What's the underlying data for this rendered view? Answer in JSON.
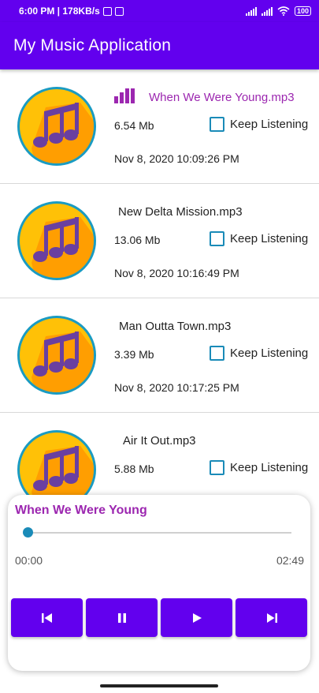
{
  "status_bar": {
    "time_speed": "6:00 PM | 178KB/s",
    "battery": "100"
  },
  "app_bar": {
    "title": "My Music Application"
  },
  "songs": [
    {
      "title": "When We Were Young.mp3",
      "size": "6.54 Mb",
      "date": "Nov 8, 2020 10:09:26 PM",
      "keep_label": "Keep Listening",
      "playing": true
    },
    {
      "title": "New Delta Mission.mp3",
      "size": "13.06 Mb",
      "date": "Nov 8, 2020 10:16:49 PM",
      "keep_label": "Keep Listening",
      "playing": false
    },
    {
      "title": "Man Outta Town.mp3",
      "size": "3.39 Mb",
      "date": "Nov 8, 2020 10:17:25 PM",
      "keep_label": "Keep Listening",
      "playing": false
    },
    {
      "title": "Air It Out.mp3",
      "size": "5.88 Mb",
      "date": "",
      "keep_label": "Keep Listening",
      "playing": false
    }
  ],
  "player": {
    "title": "When We Were Young",
    "current_time": "00:00",
    "total_time": "02:49",
    "progress": 0.0
  },
  "colors": {
    "primary": "#6200ee",
    "accent_purple": "#9c27b0",
    "accent_blue": "#1a8bb8"
  },
  "icons": {
    "song_icon": "music-note-circle-icon",
    "playing_indicator": "equalizer-icon",
    "controls": [
      "skip-previous-icon",
      "pause-icon",
      "play-icon",
      "skip-next-icon"
    ]
  }
}
